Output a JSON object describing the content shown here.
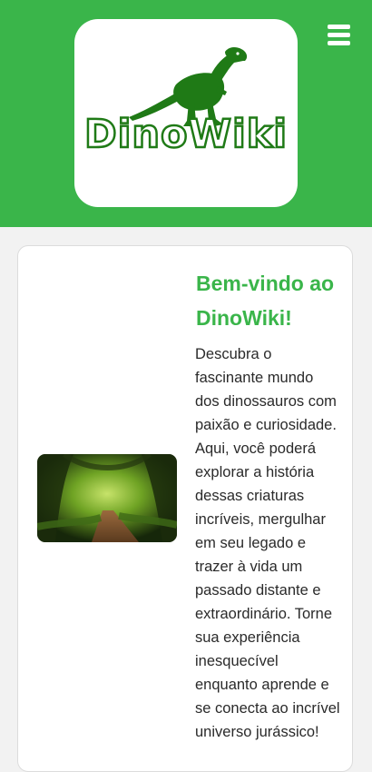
{
  "header": {
    "logo_text": "DinoWiki",
    "menu_icon": "hamburger-menu-icon",
    "background_color": "#3ab54a"
  },
  "welcome": {
    "title": "Bem-vindo ao DinoWiki!",
    "text": "Descubra o fascinante mundo dos dinossauros com paixão e curiosidade. Aqui, você poderá explorar a história dessas criaturas incríveis, mergulhar em seu legado e trazer à vida um passado distante e extraordinário. Torne sua experiência inesquecível enquanto aprende e se conecta ao incrível universo jurássico!",
    "title_color": "#3ab54a"
  }
}
